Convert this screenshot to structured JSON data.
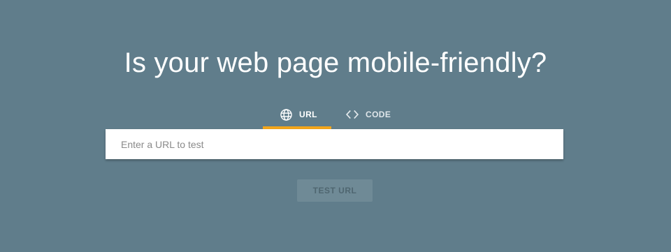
{
  "page": {
    "headline": "Is your web page mobile-friendly?"
  },
  "tabs": [
    {
      "label": "URL",
      "icon": "globe-icon",
      "active": true
    },
    {
      "label": "CODE",
      "icon": "code-icon",
      "active": false
    }
  ],
  "url_input": {
    "placeholder": "Enter a URL to test",
    "value": ""
  },
  "test_button": {
    "label": "TEST URL",
    "enabled": false
  },
  "colors": {
    "background": "#607d8b",
    "accent": "#f2a51a",
    "button_disabled": "#6f8a96"
  }
}
